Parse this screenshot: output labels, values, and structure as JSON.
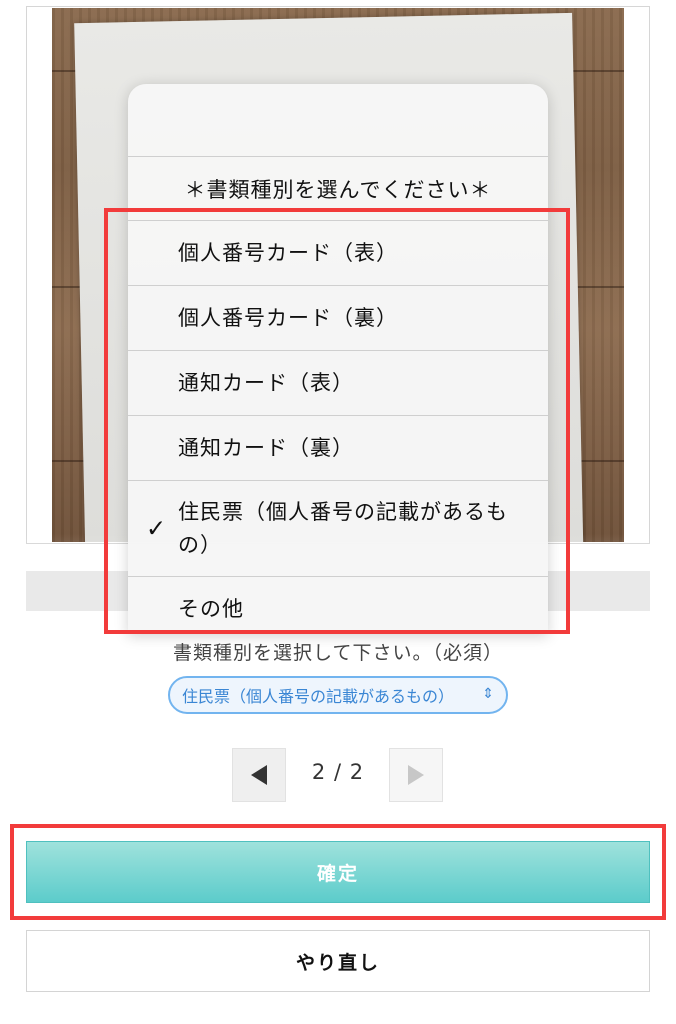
{
  "picker": {
    "header": "＊書類種別を選んでください＊",
    "options": [
      {
        "label": "個人番号カード（表）",
        "selected": false
      },
      {
        "label": "個人番号カード（裏）",
        "selected": false
      },
      {
        "label": "通知カード（表）",
        "selected": false
      },
      {
        "label": "通知カード（裏）",
        "selected": false
      },
      {
        "label": "住民票（個人番号の記載があるもの）",
        "selected": true
      },
      {
        "label": "その他",
        "selected": false
      }
    ],
    "check_icon": "checkmark-icon"
  },
  "form": {
    "select_label": "書類種別を選択して下さい。（必須）",
    "select_value": "住民票（個人番号の記載があるもの）"
  },
  "pager": {
    "page_text": "2 / 2",
    "prev_icon": "triangle-left-icon",
    "next_icon": "triangle-right-icon"
  },
  "buttons": {
    "confirm": "確定",
    "redo": "やり直し"
  },
  "colors": {
    "highlight": "#f23b3b",
    "confirm": "#5ccccb",
    "select_accent": "#3a86d4"
  }
}
